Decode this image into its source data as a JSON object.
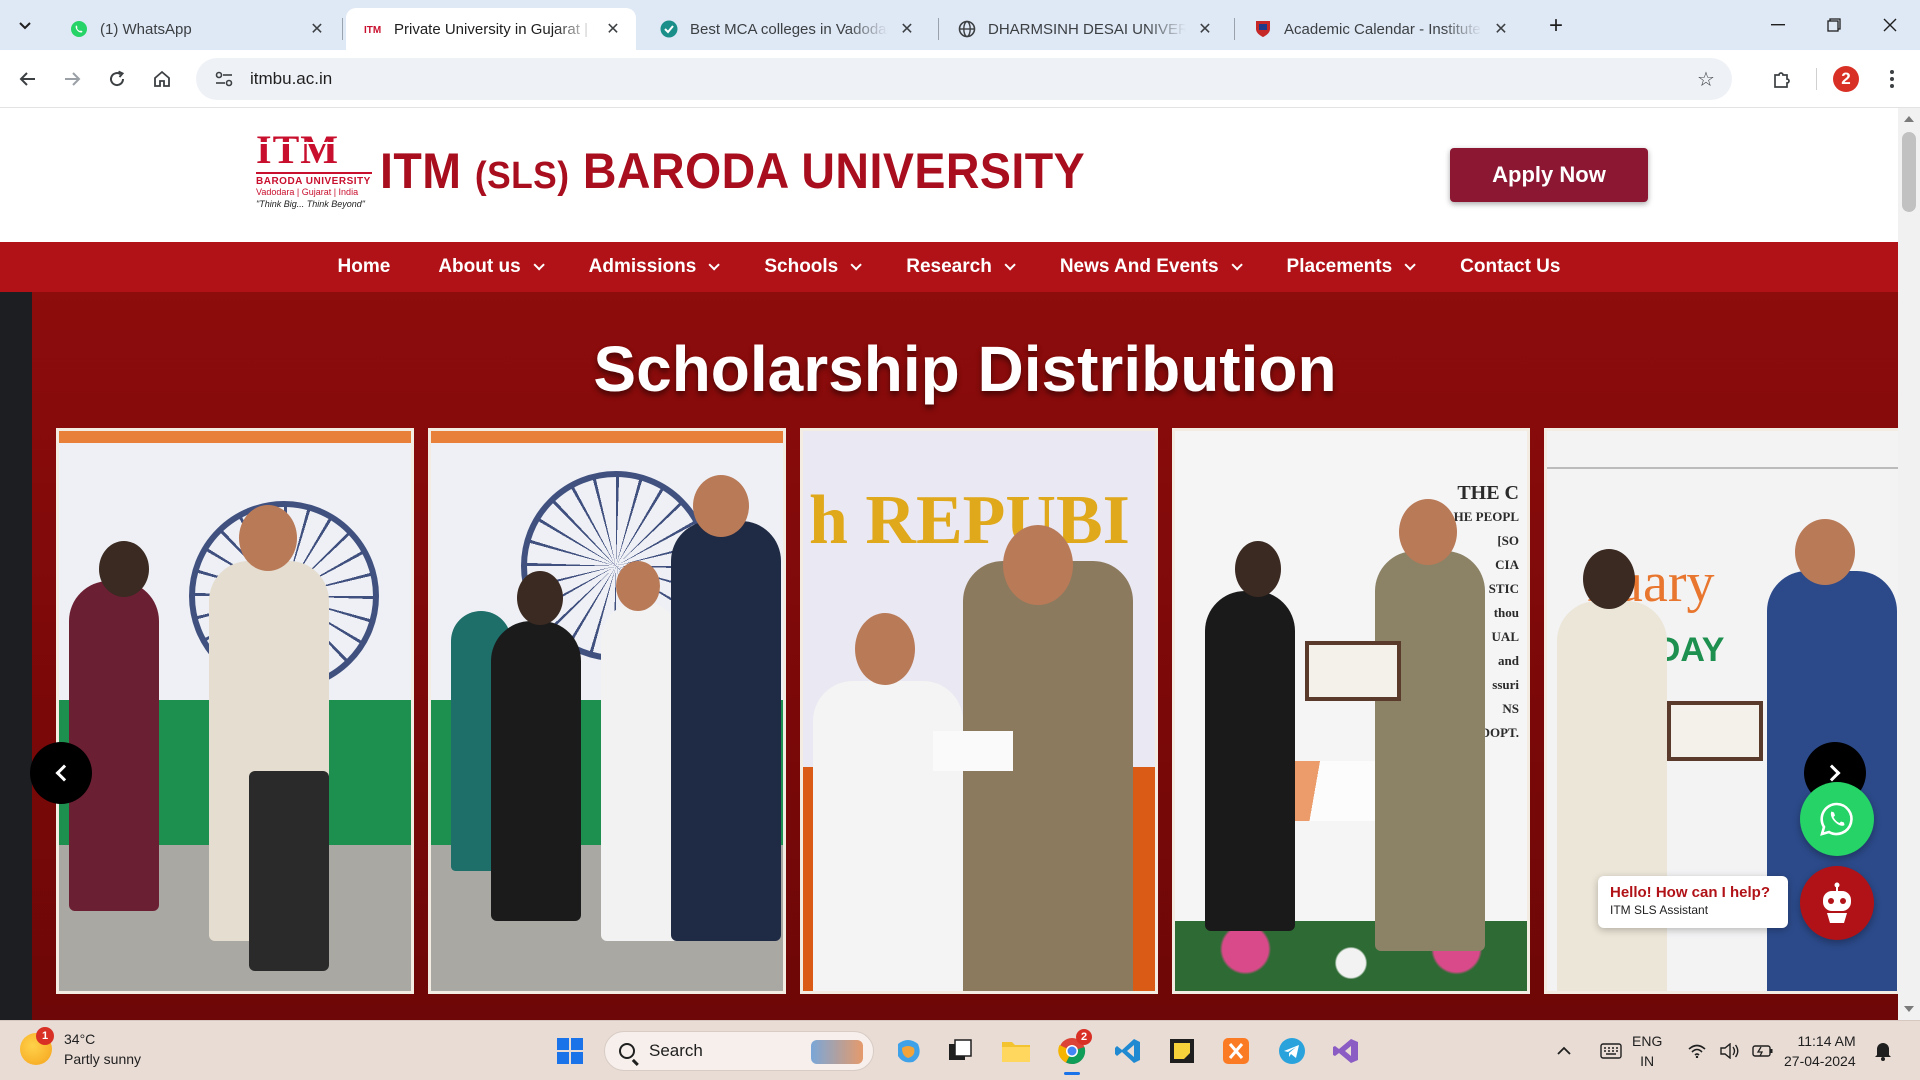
{
  "browser": {
    "tabs": [
      {
        "title": "(1) WhatsApp",
        "favicon": "whatsapp-icon"
      },
      {
        "title": "Private University in Gujarat | ITM SLS Baroda University",
        "favicon": "itm-icon"
      },
      {
        "title": "Best MCA colleges in Vadodara",
        "favicon": "shield-check-icon"
      },
      {
        "title": "DHARMSINH DESAI UNIVERSITY",
        "favicon": "globe-icon"
      },
      {
        "title": "Academic Calendar - Institute of",
        "favicon": "crest-icon"
      }
    ],
    "active_tab": 1,
    "url": "itmbu.ac.in",
    "profile_badge": "2"
  },
  "site": {
    "logo": {
      "mark": "ITM",
      "name": "BARODA UNIVERSITY",
      "location": "Vadodara | Gujarat | India",
      "tagline": "\"Think Big... Think Beyond\""
    },
    "name_part1": "ITM",
    "name_part2": "(SLS)",
    "name_part3": "BARODA UNIVERSITY",
    "apply_label": "Apply Now",
    "nav": [
      {
        "label": "Home",
        "dropdown": false
      },
      {
        "label": "About us",
        "dropdown": true
      },
      {
        "label": "Admissions",
        "dropdown": true
      },
      {
        "label": "Schools",
        "dropdown": true
      },
      {
        "label": "Research",
        "dropdown": true
      },
      {
        "label": "News And Events",
        "dropdown": true
      },
      {
        "label": "Placements",
        "dropdown": true
      },
      {
        "label": "Contact Us",
        "dropdown": false
      }
    ],
    "hero": {
      "title": "Scholarship Distribution",
      "photo_texts": {
        "p3": "h REPUBI",
        "p4_lines": [
          "THE C",
          "HE PEOPL",
          "[SO",
          "CIA",
          "STIC",
          "thou",
          "UAL",
          "and",
          "ssuri",
          "NS",
          "DOPT."
        ],
        "p5_a": "nuary",
        "p5_b": "BLIC DAY"
      }
    },
    "chat": {
      "bubble_title": "Hello! How can I help?",
      "bubble_sub": "ITM SLS Assistant"
    }
  },
  "taskbar": {
    "weather_temp": "34°C",
    "weather_desc": "Partly sunny",
    "weather_badge": "1",
    "search_label": "Search",
    "chrome_badge": "2",
    "lang_line1": "ENG",
    "lang_line2": "IN",
    "time": "11:14 AM",
    "date": "27-04-2024"
  },
  "colors": {
    "brand_red": "#a80e1e",
    "nav_red": "#b11217",
    "apply_bg": "#8b1732",
    "whatsapp_green": "#25d366"
  }
}
